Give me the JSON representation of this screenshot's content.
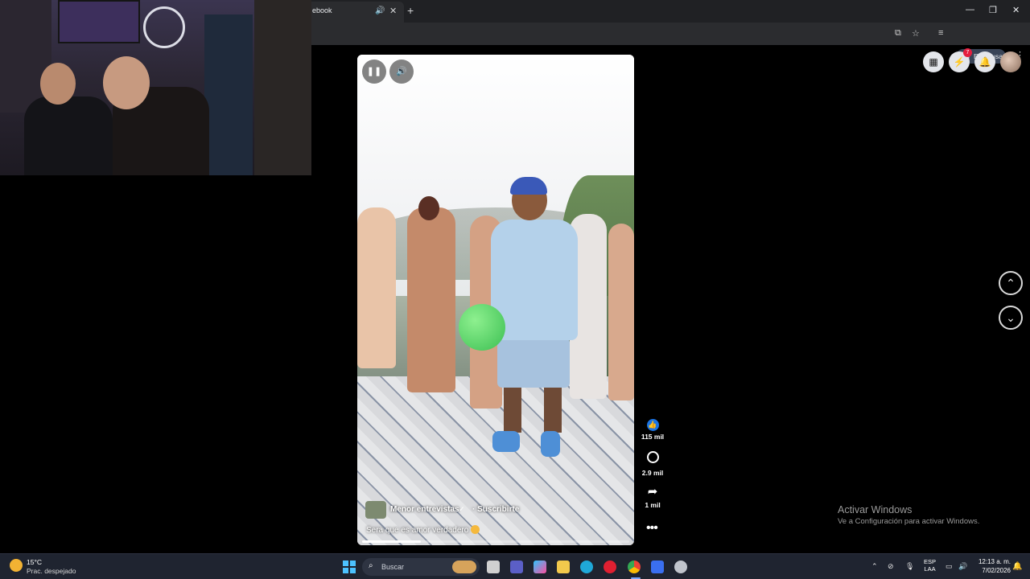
{
  "browser": {
    "tab_title": "ebook",
    "tab_audio_icon": "speaker-icon",
    "tab_close_icon": "close-icon",
    "new_tab_label": "+",
    "profile_status": "En pausa",
    "window_controls": [
      "minimize-icon",
      "restore-icon",
      "close-icon"
    ]
  },
  "video": {
    "channel_name": "Menor entrevistas",
    "verified_icon": "verified-icon",
    "subscribe_label": "· Suscribirte",
    "caption": "Sera que es amor verdadero",
    "progress_fraction": 0.22,
    "controls": [
      "pause-icon",
      "volume-icon"
    ]
  },
  "reactions": {
    "likes": "115 mil",
    "comments": "2.9 mil",
    "shares": "1 mil",
    "more_icon": "more-dots-icon"
  },
  "facebook_header": {
    "icons": [
      "menu-grid-icon",
      "messenger-icon",
      "bell-icon",
      "profile-avatar"
    ],
    "messenger_badge": "7"
  },
  "navigation": {
    "prev_icon": "chevron-up-icon",
    "next_icon": "chevron-down-icon"
  },
  "windows_watermark": {
    "title": "Activar Windows",
    "subtitle": "Ve a Configuración para activar Windows."
  },
  "taskbar": {
    "weather_temp": "15°C",
    "weather_desc": "Prac. despejado",
    "search_placeholder": "Buscar",
    "lang_line1": "ESP",
    "lang_line2": "LAA",
    "time": "12:13 a. m.",
    "date": "7/02/2026"
  },
  "colors": {
    "accent": "#1b74e4",
    "taskbar_bg": "#1f2430",
    "chrome_bg": "#202124"
  }
}
